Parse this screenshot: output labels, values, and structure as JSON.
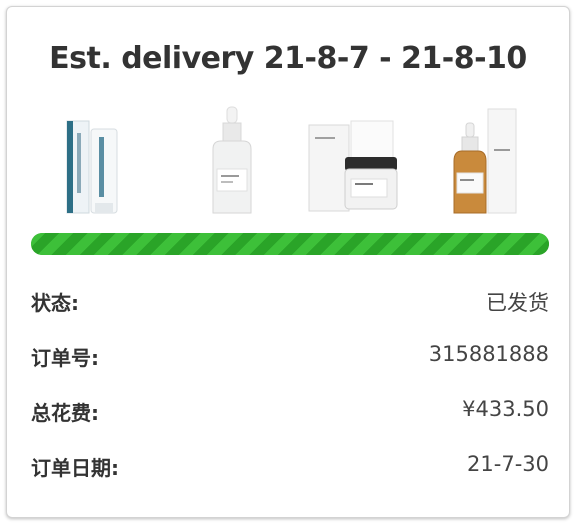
{
  "header": {
    "delivery_estimate": "Est. delivery 21-8-7 - 21-8-10"
  },
  "products": [
    {
      "icon": "toothpaste-product-image"
    },
    {
      "icon": "serum-dropper-bottle-image"
    },
    {
      "icon": "cream-jar-product-image"
    },
    {
      "icon": "amber-dropper-bottle-image"
    }
  ],
  "progress": {
    "percent": 100,
    "color": "#35b832"
  },
  "details": [
    {
      "label": "状态:",
      "value": "已发货"
    },
    {
      "label": "订单号:",
      "value": "315881888"
    },
    {
      "label": "总花费:",
      "value": "¥433.50"
    },
    {
      "label": "订单日期:",
      "value": "21-7-30"
    }
  ]
}
